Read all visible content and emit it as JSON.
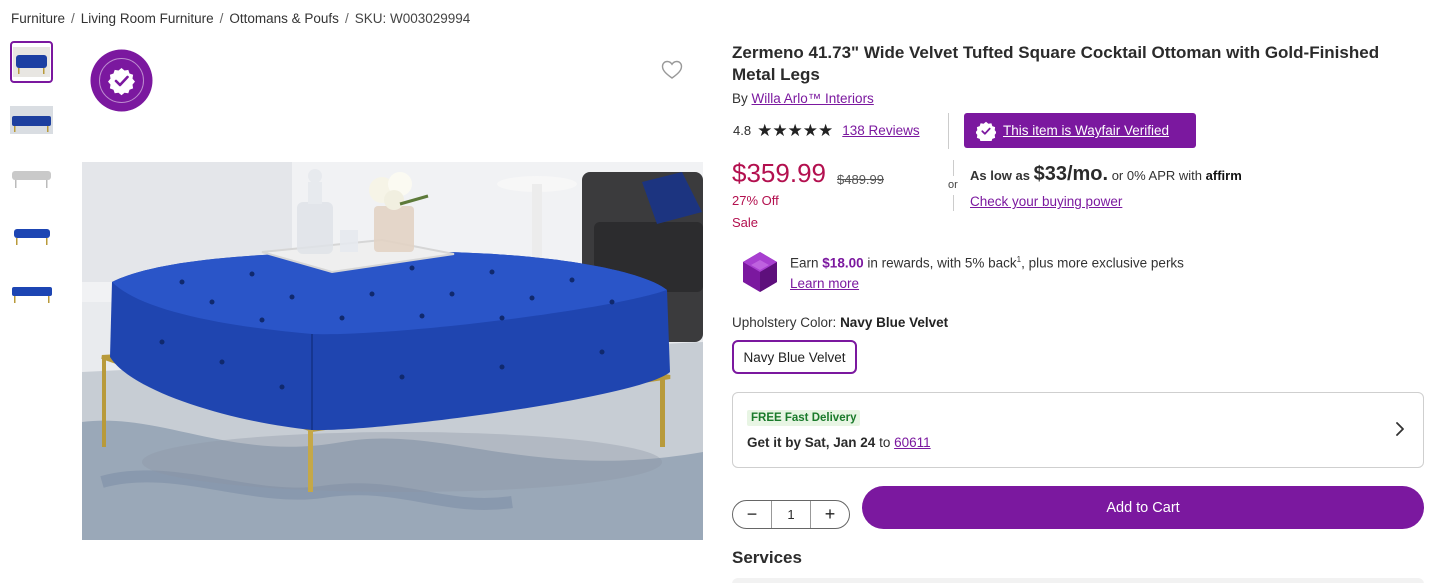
{
  "breadcrumb": {
    "items": [
      "Furniture",
      "Living Room Furniture",
      "Ottomans & Poufs"
    ],
    "separator": "/",
    "sku": "SKU: W003029994"
  },
  "gallery": {
    "thumbnail_count": 5,
    "active_thumbnail": 1,
    "badge_text": "WAYFAIR VERIFIED",
    "favorite_icon": "heart-icon"
  },
  "product": {
    "title": "Zermeno 41.73\" Wide Velvet Tufted Square Cocktail Ottoman with Gold-Finished Metal Legs",
    "by_label": "By",
    "brand": "Willa Arlo™ Interiors",
    "rating": "4.8",
    "stars": "★★★★★",
    "reviews": "138 Reviews",
    "verified_label": "This item is Wayfair Verified"
  },
  "pricing": {
    "price": "$359.99",
    "original_price": "$489.99",
    "discount": "27% Off",
    "sale_label": "Sale",
    "or_label": "or",
    "as_low_as": "As low as",
    "monthly": "$33/mo.",
    "apr_text": "or 0% APR with",
    "affirm": "affirm",
    "buying_power": "Check your buying power"
  },
  "rewards": {
    "earn": "Earn",
    "amount": "$18.00",
    "rest": "in rewards, with 5% back",
    "sup": "1",
    "tail": ", plus more exclusive perks",
    "learn_more": "Learn more"
  },
  "options": {
    "label": "Upholstery Color:",
    "selected": "Navy Blue Velvet",
    "swatch": "Navy Blue Velvet"
  },
  "delivery": {
    "tag": "FREE Fast Delivery",
    "get_it_by": "Get it by Sat, Jan 24",
    "to": "to",
    "zip": "60611"
  },
  "cart": {
    "quantity": "1",
    "minus": "−",
    "plus": "+",
    "add_label": "Add to Cart"
  },
  "services": {
    "heading": "Services"
  },
  "colors": {
    "brand_purple": "#7b189f",
    "sale_red": "#b3104f",
    "free_green": "#1a7a2b"
  }
}
